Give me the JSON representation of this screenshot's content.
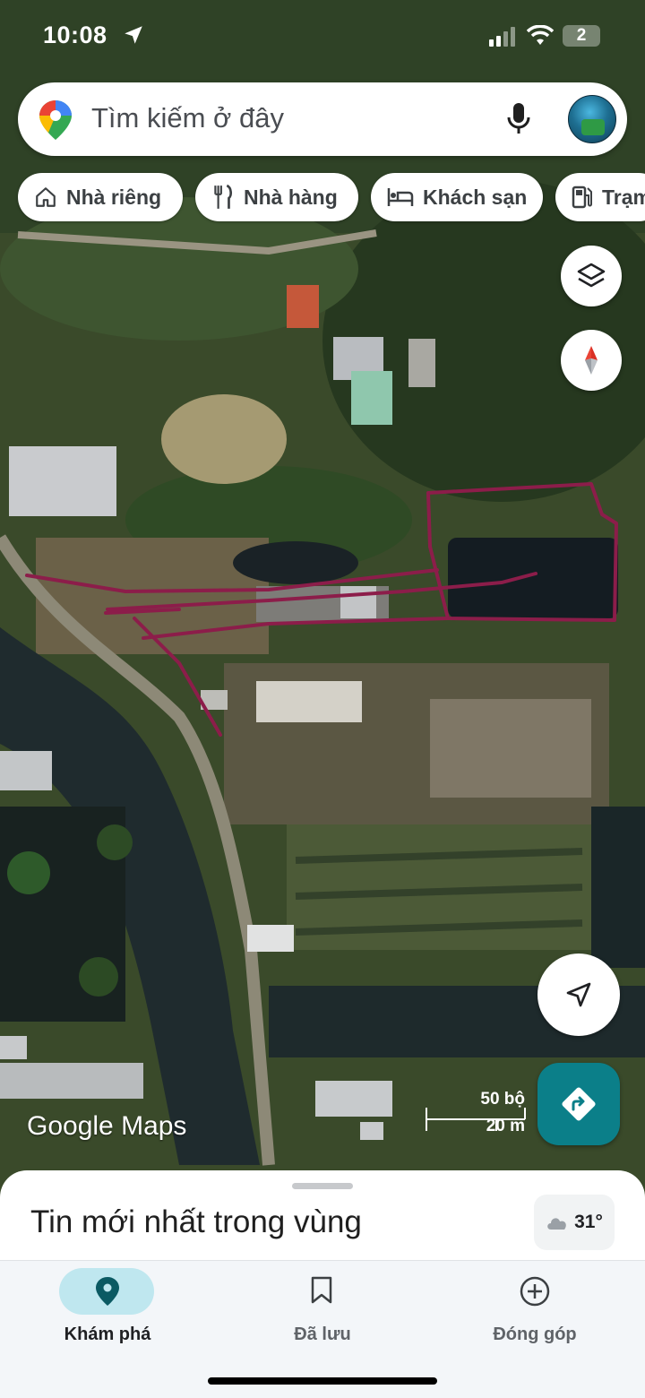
{
  "status_bar": {
    "time": "10:08",
    "battery": "2"
  },
  "search": {
    "placeholder": "Tìm kiếm ở đây"
  },
  "chips": [
    {
      "label": "Nhà riêng",
      "icon": "home-icon"
    },
    {
      "label": "Nhà hàng",
      "icon": "restaurant-icon"
    },
    {
      "label": "Khách sạn",
      "icon": "hotel-icon"
    },
    {
      "label": "Trạm",
      "icon": "gas-station-icon"
    }
  ],
  "map": {
    "scale": {
      "imperial": "50 bộ",
      "metric": "20 m"
    },
    "logo": "Google Maps",
    "annotation_color": "#8c1d4a"
  },
  "sheet": {
    "title": "Tin mới nhất trong vùng",
    "weather": "31°"
  },
  "nav": [
    {
      "label": "Khám phá",
      "icon": "explore-pin-icon",
      "active": true
    },
    {
      "label": "Đã lưu",
      "icon": "bookmark-icon",
      "active": false
    },
    {
      "label": "Đóng góp",
      "icon": "add-circle-icon",
      "active": false
    }
  ],
  "colors": {
    "accent": "#0b7f89",
    "active_pill": "#bfe7ef"
  }
}
